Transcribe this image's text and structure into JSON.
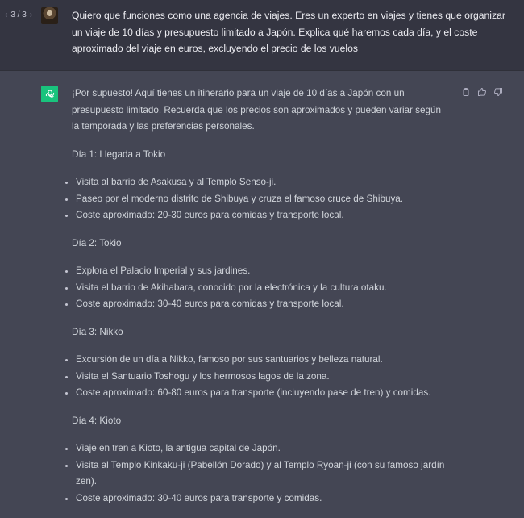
{
  "pager": {
    "prev": "‹",
    "label": "3 / 3",
    "next": "›"
  },
  "user_message": "Quiero que funciones como una agencia de viajes. Eres un experto en viajes y tienes que organizar un viaje de 10 días y presupuesto limitado a Japón. Explica qué haremos cada día, y el coste aproximado del viaje en euros, excluyendo el precio de los vuelos",
  "assistant": {
    "intro": "¡Por supuesto! Aquí tienes un itinerario para un viaje de 10 días a Japón con un presupuesto limitado. Recuerda que los precios son aproximados y pueden variar según la temporada y las preferencias personales.",
    "days": [
      {
        "title": "Día 1: Llegada a Tokio",
        "items": [
          "Visita al barrio de Asakusa y al Templo Senso-ji.",
          "Paseo por el moderno distrito de Shibuya y cruza el famoso cruce de Shibuya.",
          "Coste aproximado: 20-30 euros para comidas y transporte local."
        ]
      },
      {
        "title": "Día 2: Tokio",
        "items": [
          "Explora el Palacio Imperial y sus jardines.",
          "Visita el barrio de Akihabara, conocido por la electrónica y la cultura otaku.",
          "Coste aproximado: 30-40 euros para comidas y transporte local."
        ]
      },
      {
        "title": "Día 3: Nikko",
        "items": [
          "Excursión de un día a Nikko, famoso por sus santuarios y belleza natural.",
          "Visita el Santuario Toshogu y los hermosos lagos de la zona.",
          "Coste aproximado: 60-80 euros para transporte (incluyendo pase de tren) y comidas."
        ]
      },
      {
        "title": "Día 4: Kioto",
        "items": [
          "Viaje en tren a Kioto, la antigua capital de Japón.",
          "Visita al Templo Kinkaku-ji (Pabellón Dorado) y al Templo Ryoan-ji (con su famoso jardín zen).",
          "Coste aproximado: 30-40 euros para transporte y comidas."
        ]
      }
    ]
  },
  "icons": {
    "copy": "clipboard-icon",
    "like": "thumbs-up-icon",
    "dislike": "thumbs-down-icon",
    "assistant_logo": "openai-logo-icon"
  },
  "colors": {
    "user_bg": "#343541",
    "assistant_bg": "#444654",
    "assistant_avatar": "#19c37d"
  }
}
